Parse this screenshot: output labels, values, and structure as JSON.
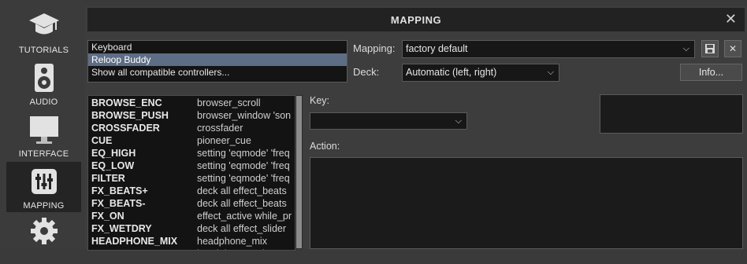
{
  "sidebar": {
    "items": [
      {
        "label": "TUTORIALS",
        "icon": "graduation-cap-icon"
      },
      {
        "label": "AUDIO",
        "icon": "speaker-icon"
      },
      {
        "label": "INTERFACE",
        "icon": "monitor-icon"
      },
      {
        "label": "MAPPING",
        "icon": "sliders-icon"
      },
      {
        "label": "",
        "icon": "gear-icon"
      }
    ],
    "active": "MAPPING"
  },
  "dialog": {
    "title": "MAPPING",
    "controllers": [
      "Keyboard",
      "Reloop Buddy",
      "Show all compatible controllers..."
    ],
    "selected_controller": "Reloop Buddy",
    "mapping_label": "Mapping:",
    "mapping_value": "factory default",
    "deck_label": "Deck:",
    "deck_value": "Automatic (left, right)",
    "info_button": "Info...",
    "key_label": "Key:",
    "key_value": "",
    "action_label": "Action:",
    "mappings": [
      {
        "key": "BROWSE_ENC",
        "action": "browser_scroll"
      },
      {
        "key": "BROWSE_PUSH",
        "action": "browser_window 'son"
      },
      {
        "key": "CROSSFADER",
        "action": "crossfader"
      },
      {
        "key": "CUE",
        "action": "pioneer_cue"
      },
      {
        "key": "EQ_HIGH",
        "action": "setting 'eqmode' 'freq"
      },
      {
        "key": "EQ_LOW",
        "action": "setting 'eqmode' 'freq"
      },
      {
        "key": "FILTER",
        "action": "setting 'eqmode' 'freq"
      },
      {
        "key": "FX_BEATS+",
        "action": "deck all effect_beats"
      },
      {
        "key": "FX_BEATS-",
        "action": "deck all effect_beats"
      },
      {
        "key": "FX_ON",
        "action": "effect_active while_pr"
      },
      {
        "key": "FX_WETDRY",
        "action": "deck all effect_slider"
      },
      {
        "key": "HEADPHONE_MIX",
        "action": "headphone_mix"
      },
      {
        "key": "HEADPHONE_VOL",
        "action": "headphone_volume"
      }
    ]
  },
  "colors": {
    "accent_selection": "#5d6d86",
    "panel": "#3d3d3d",
    "titlebar": "#222222"
  }
}
